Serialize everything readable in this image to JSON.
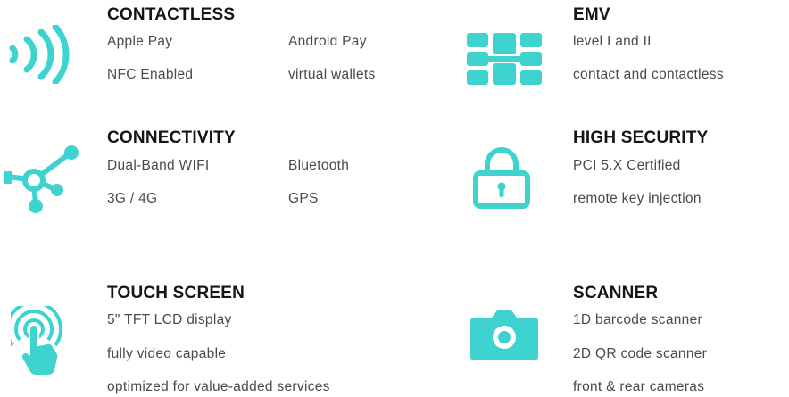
{
  "accent_color": "#3fd3d0",
  "features": {
    "contactless": {
      "icon": "nfc-waves-icon",
      "title": "CONTACTLESS",
      "items": [
        "Apple Pay",
        "Android Pay",
        "NFC Enabled",
        "virtual wallets"
      ]
    },
    "emv": {
      "icon": "emv-chip-icon",
      "title": "EMV",
      "items": [
        "level I and II",
        "contact and contactless"
      ]
    },
    "connectivity": {
      "icon": "network-nodes-icon",
      "title": "CONNECTIVITY",
      "items": [
        "Dual-Band WIFI",
        "Bluetooth",
        "3G / 4G",
        "GPS"
      ]
    },
    "security": {
      "icon": "padlock-icon",
      "title": "HIGH SECURITY",
      "items": [
        "PCI 5.X Certified",
        "remote key injection"
      ]
    },
    "touch": {
      "icon": "touch-hand-icon",
      "title": "TOUCH SCREEN",
      "items": [
        "5\" TFT LCD display",
        "fully video capable",
        "optimized for value-added services"
      ]
    },
    "scanner": {
      "icon": "camera-icon",
      "title": "SCANNER",
      "items": [
        "1D barcode scanner",
        "2D QR code scanner",
        "front & rear cameras"
      ]
    }
  }
}
